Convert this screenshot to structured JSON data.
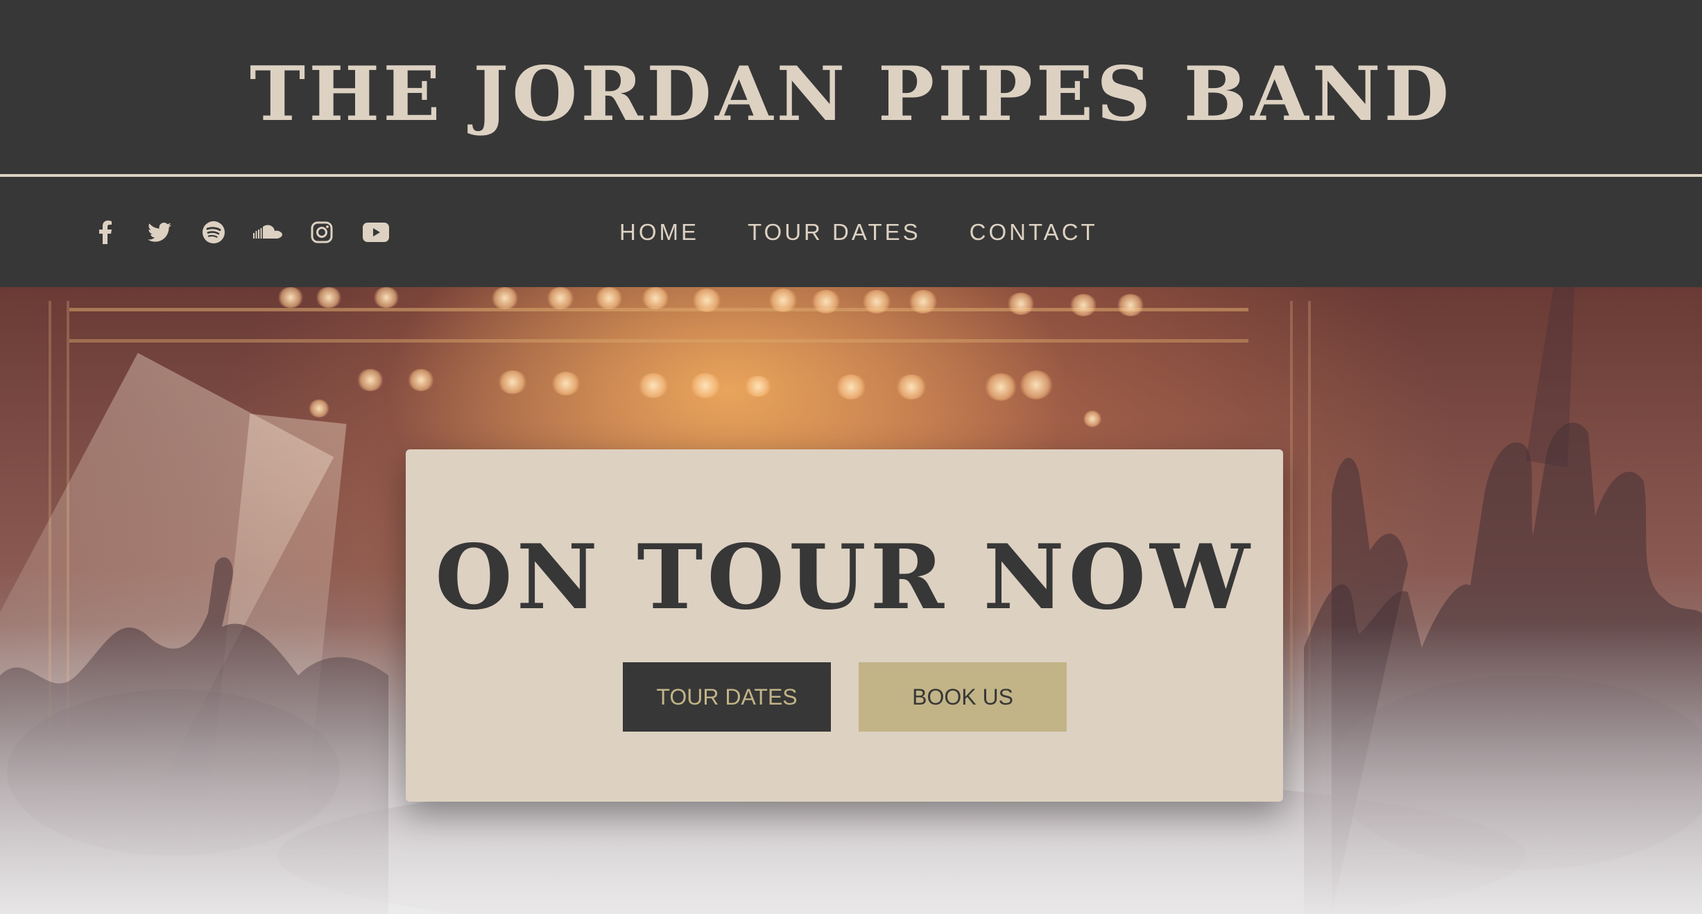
{
  "header": {
    "title": "THE JORDAN PIPES BAND"
  },
  "social": [
    {
      "icon": "facebook-icon"
    },
    {
      "icon": "twitter-icon"
    },
    {
      "icon": "spotify-icon"
    },
    {
      "icon": "soundcloud-icon"
    },
    {
      "icon": "instagram-icon"
    },
    {
      "icon": "youtube-icon"
    }
  ],
  "nav": {
    "items": [
      {
        "label": "HOME"
      },
      {
        "label": "TOUR DATES"
      },
      {
        "label": "CONTACT"
      }
    ]
  },
  "hero": {
    "heading": "ON TOUR NOW",
    "primary_button": "TOUR DATES",
    "secondary_button": "BOOK US"
  },
  "colors": {
    "dark": "#373737",
    "cream": "#ddd1c2",
    "gold": "#c2b487"
  }
}
